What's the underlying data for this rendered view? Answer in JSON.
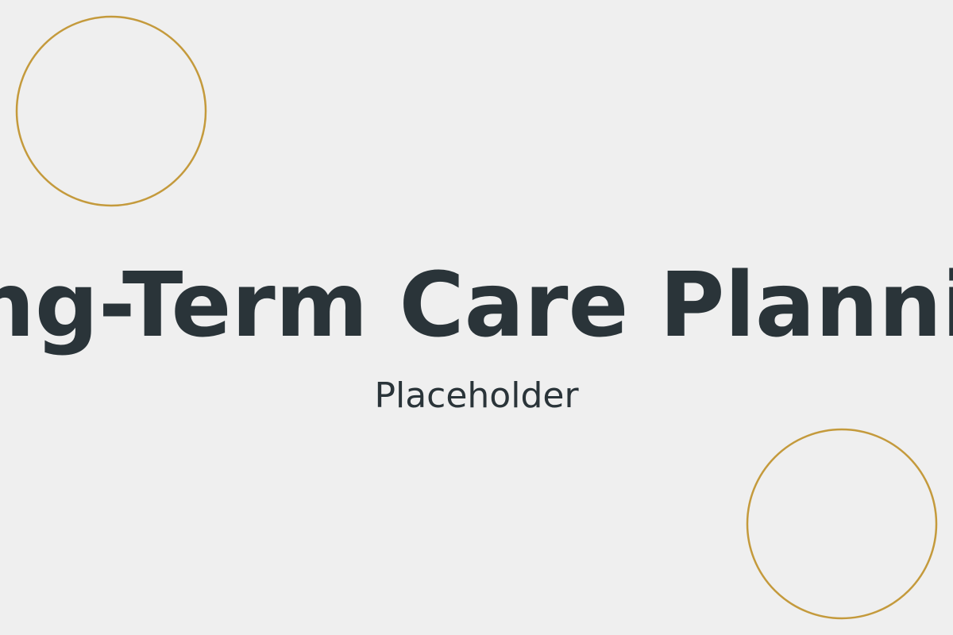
{
  "title": "Long-Term Care Planning",
  "subtitle": "Placeholder",
  "colors": {
    "background": "#efefef",
    "text": "#2a3439",
    "accent": "#c49a3c"
  }
}
